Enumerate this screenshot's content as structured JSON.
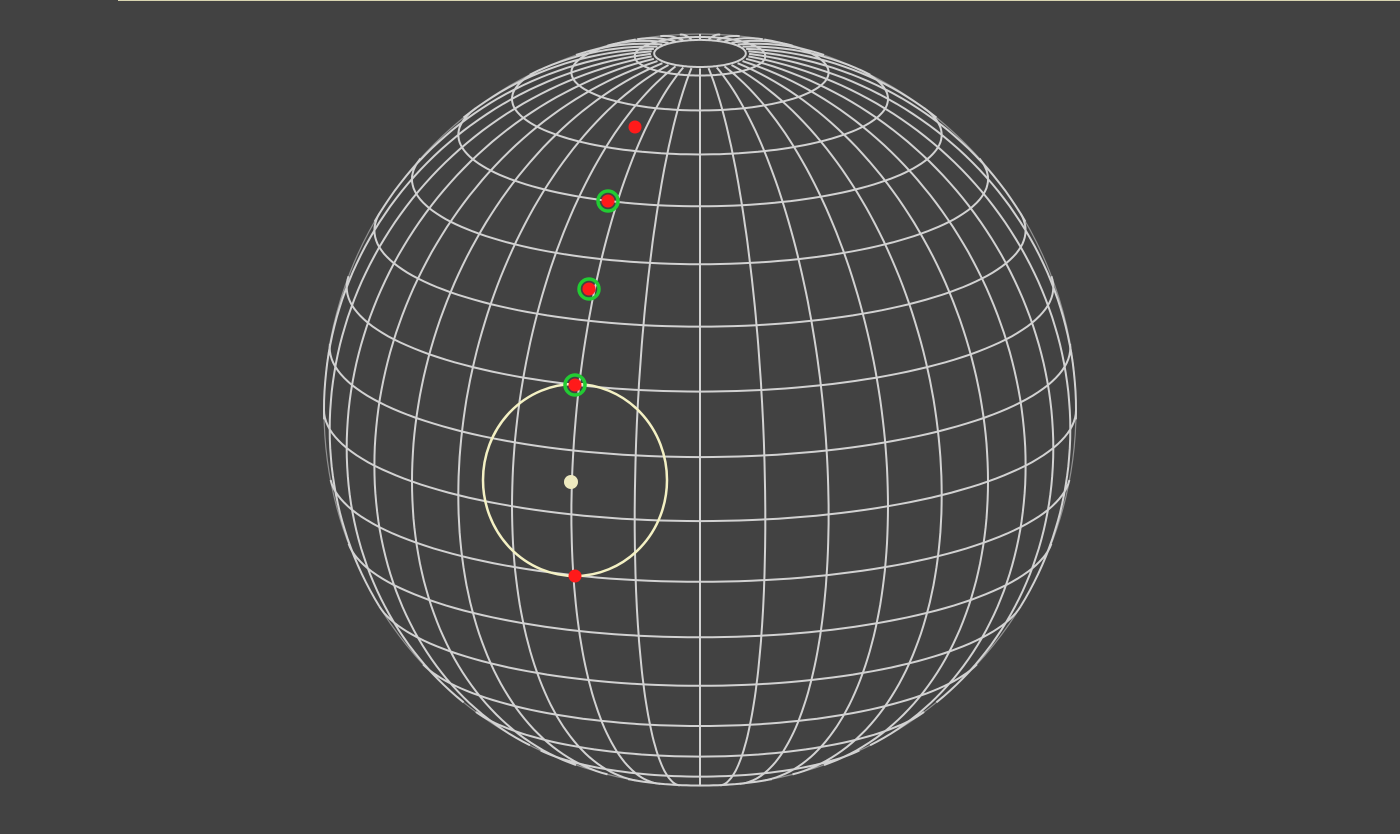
{
  "scene": {
    "background_color": "#424242",
    "sphere": {
      "grid_color": "#d2d2d2",
      "latitude_band_count": 18,
      "longitude_line_count": 36,
      "north_pole_cap": "open"
    },
    "path_markers": {
      "marker_color": "#ff1a1a",
      "highlight_ring_color": "#22cc33",
      "markers": [
        {
          "id": "marker-1",
          "highlighted": false
        },
        {
          "id": "marker-2",
          "highlighted": true
        },
        {
          "id": "marker-3",
          "highlighted": true
        },
        {
          "id": "marker-4",
          "highlighted": true
        },
        {
          "id": "marker-5",
          "highlighted": false
        }
      ]
    },
    "selection_circle": {
      "color": "#f4f1c4",
      "center_dot_color": "#eeeac0"
    },
    "top_border_color": "#d8d4b0"
  }
}
